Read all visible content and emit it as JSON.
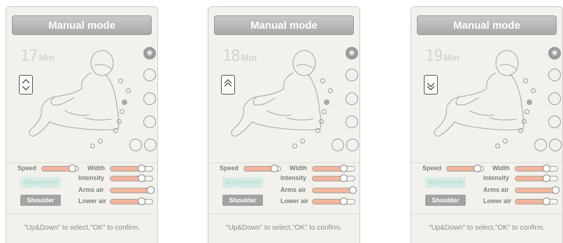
{
  "panels": [
    {
      "title": "Manual mode",
      "timer": {
        "minutes": "17",
        "unit": "Min"
      },
      "direction": "up-down",
      "controls": {
        "speed": {
          "label": "Speed",
          "value": 0.82
        },
        "width": {
          "label": "Width",
          "value": 0.74
        },
        "intensity": {
          "label": "Intensity",
          "value": 0.74
        },
        "arms_air": {
          "label": "Arms air",
          "value": 0.95
        },
        "lower_air": {
          "label": "Lower air",
          "value": 0.74
        }
      },
      "adjustment_label": "Adjustment",
      "shoulder_label": "Shoulder",
      "hint": "\"Up&Down\" to select,\"OK\" to confirm."
    },
    {
      "title": "Manual mode",
      "timer": {
        "minutes": "18",
        "unit": "Min"
      },
      "direction": "up",
      "controls": {
        "speed": {
          "label": "Speed",
          "value": 0.82
        },
        "width": {
          "label": "Width",
          "value": 0.74
        },
        "intensity": {
          "label": "Intensity",
          "value": 0.74
        },
        "arms_air": {
          "label": "Arms air",
          "value": 0.95
        },
        "lower_air": {
          "label": "Lower air",
          "value": 0.74
        }
      },
      "adjustment_label": "Adjustment",
      "shoulder_label": "Shoulder",
      "hint": "\"Up&Down\" to select,\"OK\" to confirm."
    },
    {
      "title": "Manual mode",
      "timer": {
        "minutes": "19",
        "unit": "Min"
      },
      "direction": "down",
      "controls": {
        "speed": {
          "label": "Speed",
          "value": 0.82
        },
        "width": {
          "label": "Width",
          "value": 0.74
        },
        "intensity": {
          "label": "Intensity",
          "value": 0.74
        },
        "arms_air": {
          "label": "Arms air",
          "value": 0.95
        },
        "lower_air": {
          "label": "Lower air",
          "value": 0.74
        }
      },
      "adjustment_label": "Adjustment",
      "shoulder_label": "Shoulder",
      "hint": "\"Up&Down\" to select,\"OK\" to confirm."
    }
  ],
  "icons": {
    "mode_icon": "massage-hand-icon",
    "body_figure": "reclining-body-icon",
    "direction_up_down": "chevron-up-down-icon",
    "direction_up": "double-chevron-up-icon",
    "direction_down": "double-chevron-down-icon"
  },
  "colors": {
    "slider_fill": "#f2b59c",
    "title_bar": "#b5b5b5",
    "adjustment_bg": "#d6ece6",
    "shoulder_bg": "#a3a3a3",
    "active_point": "#a9a9a9"
  }
}
